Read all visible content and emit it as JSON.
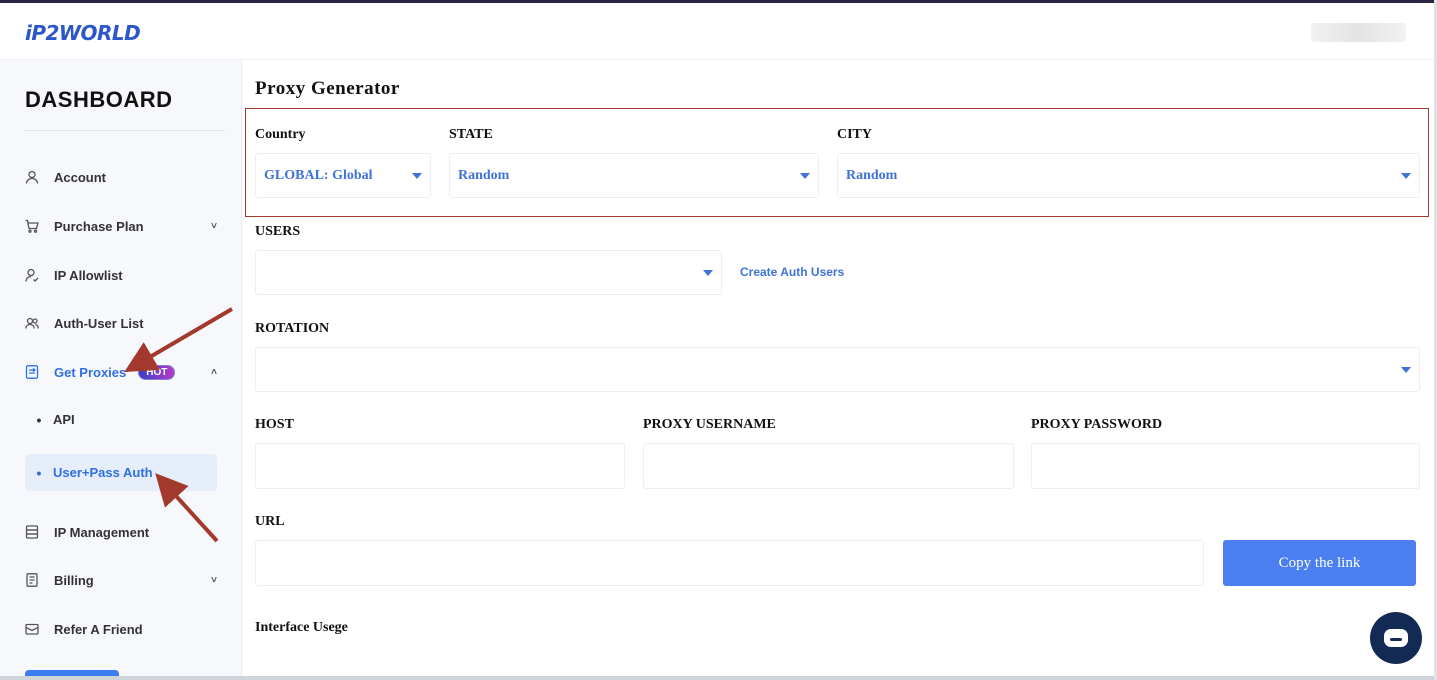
{
  "brand": {
    "logo_text": "iP2WORLD",
    "accent": "#2f6fe0"
  },
  "sidebar": {
    "title": "DASHBOARD",
    "items": [
      {
        "label": "Account",
        "icon": "user-icon"
      },
      {
        "label": "Purchase Plan",
        "icon": "cart-icon",
        "chevron": "˅"
      },
      {
        "label": "IP Allowlist",
        "icon": "user-check-icon"
      },
      {
        "label": "Auth-User List",
        "icon": "users-icon"
      },
      {
        "label": "Get Proxies",
        "icon": "proxy-icon",
        "badge": "HOT",
        "chevron": "˄",
        "active": true
      },
      {
        "label": "IP Management",
        "icon": "server-icon"
      },
      {
        "label": "Billing",
        "icon": "receipt-icon",
        "chevron": "˅"
      },
      {
        "label": "Refer A Friend",
        "icon": "mail-icon"
      }
    ],
    "sub_items": [
      {
        "label": "API"
      },
      {
        "label": "User+Pass Auth",
        "selected": true
      }
    ]
  },
  "main": {
    "title": "Proxy Generator",
    "country": {
      "label": "Country",
      "value": "GLOBAL: Global"
    },
    "state": {
      "label": "STATE",
      "value": "Random"
    },
    "city": {
      "label": "CITY",
      "value": "Random"
    },
    "users": {
      "label": "USERS",
      "value": "",
      "create_link": "Create Auth Users"
    },
    "rotation": {
      "label": "ROTATION",
      "value": ""
    },
    "host": {
      "label": "HOST",
      "value": ""
    },
    "proxy_username": {
      "label": "PROXY USERNAME",
      "value": ""
    },
    "proxy_password": {
      "label": "PROXY PASSWORD",
      "value": ""
    },
    "url": {
      "label": "URL",
      "value": ""
    },
    "copy_button": "Copy the link",
    "interface_usage": "Interface Usege"
  },
  "colors": {
    "annotation": "#a3382c",
    "button": "#4b7ff0",
    "chat": "#132a55"
  }
}
